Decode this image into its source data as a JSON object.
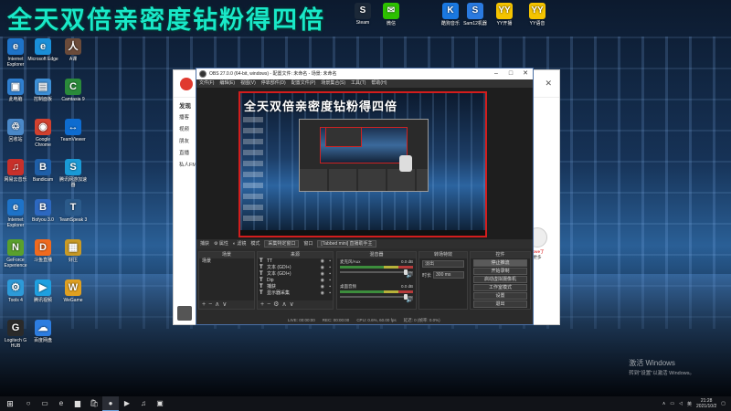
{
  "overlay_title": "全天双倍亲密度钻粉得四倍",
  "desktop": {
    "left_icons": [
      {
        "label": "Internet Explorer",
        "icon": "ie-icon",
        "color": "#1e73c8",
        "glyph": "e"
      },
      {
        "label": "Microsoft Edge",
        "icon": "edge-icon",
        "color": "#1a8fd8",
        "glyph": "e"
      },
      {
        "label": "A课",
        "icon": "avatar-icon",
        "color": "#6b4b3a",
        "glyph": "人"
      },
      {
        "label": "此电脑",
        "icon": "computer-icon",
        "color": "#2f7fd0",
        "glyph": "▣"
      },
      {
        "label": "控制面板",
        "icon": "control-panel-icon",
        "color": "#3d8fd6",
        "glyph": "▤"
      },
      {
        "label": "Camtasia 9",
        "icon": "camtasia-icon",
        "color": "#2a8a3a",
        "glyph": "C"
      },
      {
        "label": "回收站",
        "icon": "recycle-bin-icon",
        "color": "#4a88c8",
        "glyph": "♲"
      },
      {
        "label": "Google Chrome",
        "icon": "chrome-icon",
        "color": "#d2412f",
        "glyph": "◉"
      },
      {
        "label": "TeamViewer",
        "icon": "teamviewer-icon",
        "color": "#0e6cd0",
        "glyph": "↔"
      },
      {
        "label": "网易云音乐",
        "icon": "music-icon",
        "color": "#c8302a",
        "glyph": "♫"
      },
      {
        "label": "Bandicam",
        "icon": "bandicam-icon",
        "color": "#1f5fa8",
        "glyph": "B"
      },
      {
        "label": "腾讯网游加速器",
        "icon": "accelerator-icon",
        "color": "#1a9ad6",
        "glyph": "S"
      },
      {
        "label": "Internet Explorer",
        "icon": "ie2-icon",
        "color": "#1e73c8",
        "glyph": "e"
      },
      {
        "label": "Bofyou 3.0",
        "icon": "bofyou-icon",
        "color": "#2d68c0",
        "glyph": "B"
      },
      {
        "label": "TeamSpeak 3",
        "icon": "teamspeak-icon",
        "color": "#2b5a8a",
        "glyph": "T"
      },
      {
        "label": "GeForce Experience",
        "icon": "geforce-icon",
        "color": "#5aa02c",
        "glyph": "N"
      },
      {
        "label": "斗鱼直播",
        "icon": "douyu-icon",
        "color": "#f06a1e",
        "glyph": "D"
      },
      {
        "label": "好压",
        "icon": "archive-icon",
        "color": "#c99a25",
        "glyph": "▦"
      },
      {
        "label": "Tools 4",
        "icon": "tools-icon",
        "color": "#2d9ad8",
        "glyph": "⚙"
      },
      {
        "label": "腾讯视频",
        "icon": "tencent-video-icon",
        "color": "#1fa0e0",
        "glyph": "▶"
      },
      {
        "label": "WeGame",
        "icon": "wegame-icon",
        "color": "#e0a020",
        "glyph": "W"
      },
      {
        "label": "Logitech G HUB",
        "icon": "logitech-icon",
        "color": "#2a2a2a",
        "glyph": "G"
      },
      {
        "label": "百度网盘",
        "icon": "baidu-disk-icon",
        "color": "#2d7de0",
        "glyph": "☁"
      }
    ],
    "top_icons": [
      {
        "label": "Steam",
        "icon": "steam-icon",
        "color": "#1b2838",
        "glyph": "S"
      },
      {
        "label": "微信",
        "icon": "wechat-icon",
        "color": "#2dc100",
        "glyph": "✉"
      },
      {
        "label": "酷狗音乐",
        "icon": "kugou-icon",
        "color": "#1a78e0",
        "glyph": "K"
      },
      {
        "label": "Sam12机器",
        "icon": "sam-icon",
        "color": "#2a7ae0",
        "glyph": "S"
      },
      {
        "label": "YY开播",
        "icon": "yy-live-icon",
        "color": "#f5c400",
        "glyph": "YY"
      },
      {
        "label": "YY语音",
        "icon": "yy-voice-icon",
        "color": "#f5c400",
        "glyph": "YY"
      }
    ],
    "activate_windows": {
      "line1": "激活 Windows",
      "line2": "转到\"设置\"以激活 Windows。"
    }
  },
  "obs": {
    "title": "OBS 27.0.0 (64-bit, windows) - 配置文件: 未命名 - 场景: 未命名",
    "menu": [
      "文件(F)",
      "编辑(E)",
      "视图(V)",
      "停靠部件(D)",
      "配置文件(P)",
      "场景集合(S)",
      "工具(T)",
      "帮助(H)"
    ],
    "source_toolbar": {
      "label": "捕获",
      "properties": "属性",
      "filters": "滤镜",
      "mode_label": "模式",
      "mode_value": "采集特定窗口",
      "window_label": "窗口",
      "window_value": "[Tabbed mini] 直播助手主"
    },
    "docks": {
      "scenes": {
        "title": "场景",
        "items": [
          "场景"
        ]
      },
      "sources": {
        "title": "来源",
        "items": [
          "TT",
          "文本 (GDI+)",
          "文本 (GDI+)",
          "Dip",
          "捕获",
          "显示器采集"
        ]
      },
      "mixer": {
        "title": "混音器",
        "channels": [
          {
            "name": "麦克风/Aux",
            "db": "0.0 dB"
          },
          {
            "name": "桌面音频",
            "db": "0.0 dB"
          }
        ]
      },
      "transitions": {
        "title": "转场特效",
        "type": "淡出",
        "duration_label": "时长",
        "duration": "300 ms"
      },
      "controls": {
        "title": "控件",
        "buttons": [
          "停止推流",
          "开始录制",
          "启动虚拟摄像机",
          "工作室模式",
          "设置",
          "退出"
        ]
      }
    },
    "status": [
      "LIVE: 00:00:00",
      "REC: 00:00:00",
      "CPU: 0.6%, 60.00 fps",
      "延迟: 0 (帧率: 0.0%)"
    ]
  },
  "browser": {
    "menu": [
      "发现",
      "播客",
      "视频",
      "朋友",
      "直播",
      "私人FM"
    ],
    "right_panel": {
      "name": "Love了",
      "link": "更多"
    }
  },
  "taskbar": {
    "apps": [
      "search-icon",
      "task-view-icon",
      "edge-icon",
      "folder-icon",
      "store-icon",
      "obs-icon",
      "media-icon",
      "music-icon",
      "app-icon"
    ],
    "clock_time": "21:28",
    "clock_date": "2021/10/2",
    "ime": "英"
  }
}
